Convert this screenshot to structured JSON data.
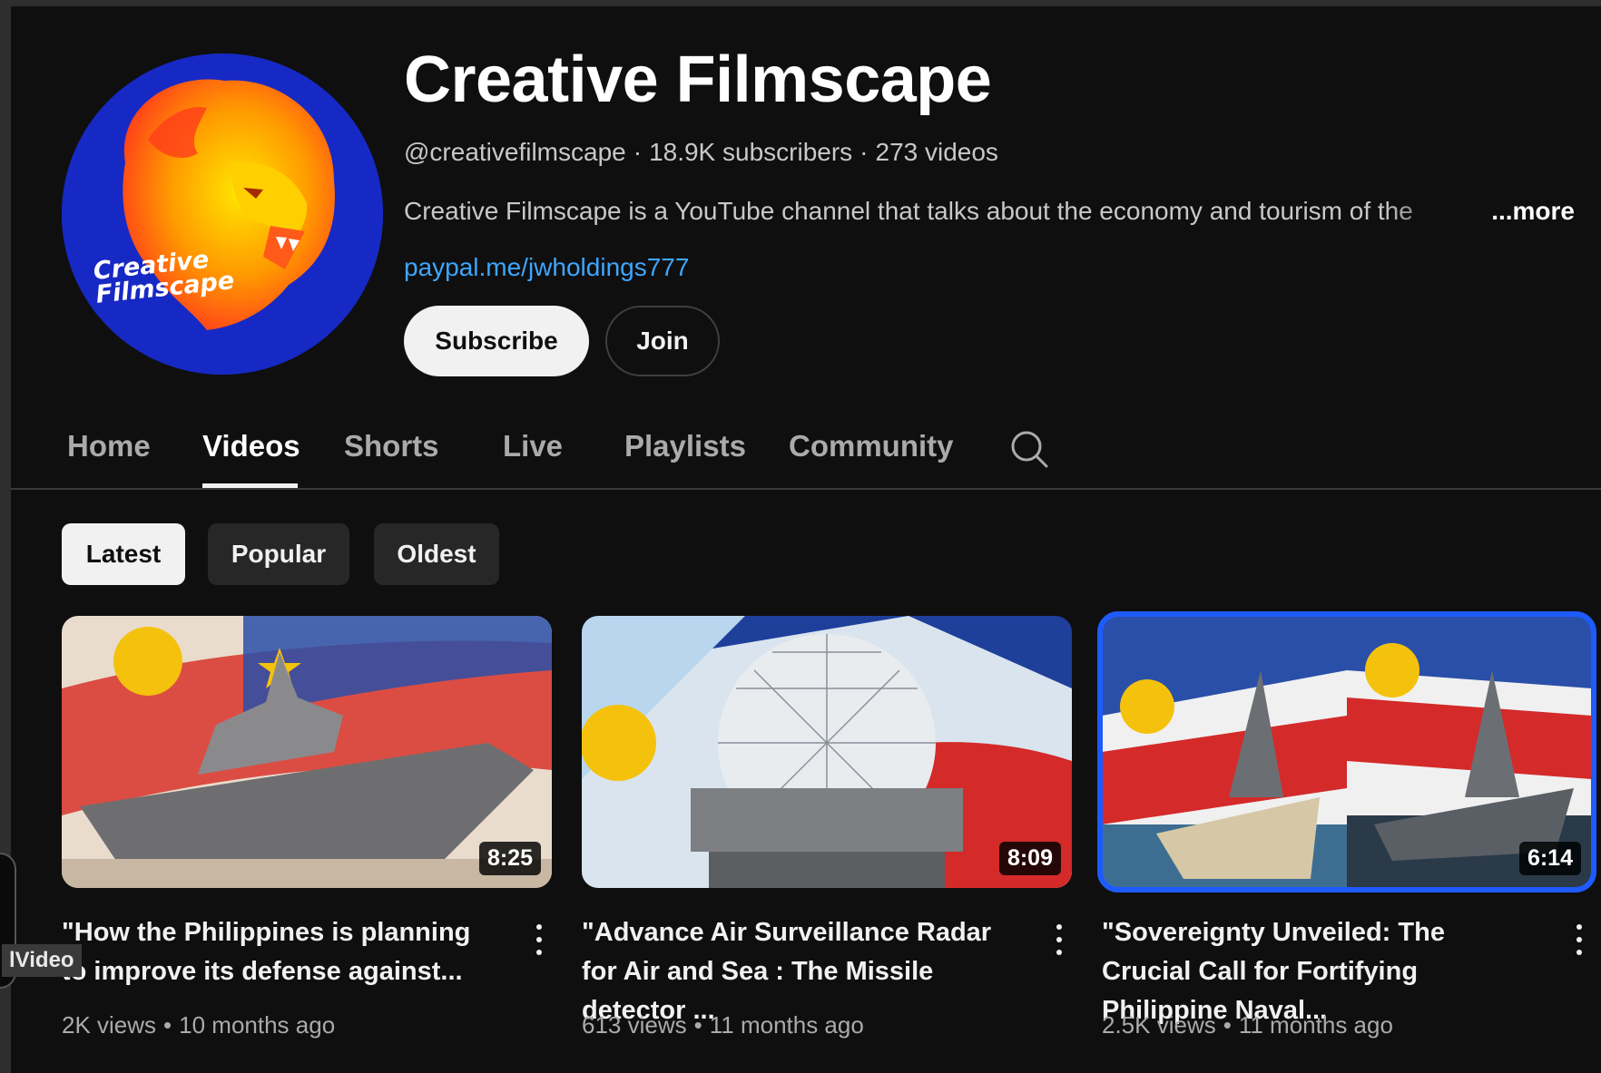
{
  "channel": {
    "name": "Creative Filmscape",
    "logo_line1": "Creative",
    "logo_line2": "Filmscape",
    "handle": "@creativefilmscape",
    "subscribers": "18.9K subscribers",
    "video_count": "273 videos",
    "description": "Creative Filmscape is a YouTube channel that talks about the economy and tourism of the",
    "more_label": "...more",
    "link": "paypal.me/jwholdings777",
    "subscribe_label": "Subscribe",
    "join_label": "Join"
  },
  "tabs": [
    {
      "label": "Home"
    },
    {
      "label": "Videos",
      "active": true
    },
    {
      "label": "Shorts"
    },
    {
      "label": "Live"
    },
    {
      "label": "Playlists"
    },
    {
      "label": "Community"
    }
  ],
  "filters": [
    {
      "label": "Latest",
      "active": true
    },
    {
      "label": "Popular"
    },
    {
      "label": "Oldest"
    }
  ],
  "videos": [
    {
      "title": "\"How the Philippines is planning to improve its defense against...",
      "duration": "8:25",
      "views": "2K views",
      "age": "10 months ago"
    },
    {
      "title": "\"Advance Air Surveillance Radar for Air and Sea : The Missile detector ...",
      "duration": "8:09",
      "views": "613 views",
      "age": "11 months ago"
    },
    {
      "title": "\"Sovereignty Unveiled: The Crucial Call for Fortifying Philippine Naval...",
      "duration": "6:14",
      "views": "2.5K views",
      "age": "11 months ago"
    }
  ],
  "overlay_tag": "lVideo",
  "colors": {
    "background": "#0f0f0f",
    "link": "#3ea6ff",
    "selection": "#1e5bff",
    "avatar_blue": "#1729c4"
  }
}
